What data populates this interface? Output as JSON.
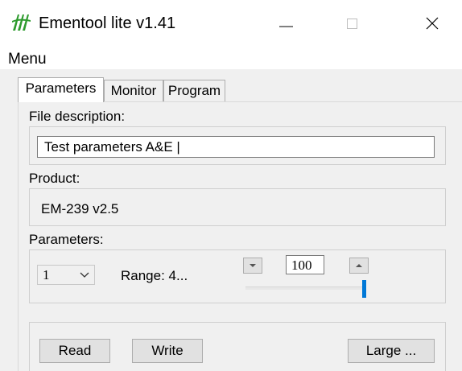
{
  "window": {
    "title": "Ementool lite v1.41",
    "icon": "ementool-logo-icon",
    "controls": [
      "minimize-icon",
      "maximize-icon",
      "close-icon"
    ]
  },
  "menu": {
    "items": [
      {
        "label": "Menu"
      }
    ]
  },
  "tabs": [
    {
      "label": "Parameters",
      "selected": true
    },
    {
      "label": "Monitor",
      "selected": false
    },
    {
      "label": "Program",
      "selected": false
    }
  ],
  "file_description": {
    "label": "File description:",
    "value": "Test parameters A&E |"
  },
  "product": {
    "label": "Product:",
    "value": "EM-239  v2.5"
  },
  "parameters": {
    "label": "Parameters:",
    "selected_index": "1",
    "range_text": "Range: 4...",
    "value": "100",
    "slider_fraction": 1.0
  },
  "buttons": {
    "read": "Read",
    "write": "Write",
    "large": "Large ..."
  },
  "colors": {
    "accent": "#0078d7",
    "logo": "#2e9b2e",
    "panel_bg": "#f0f0f0"
  }
}
